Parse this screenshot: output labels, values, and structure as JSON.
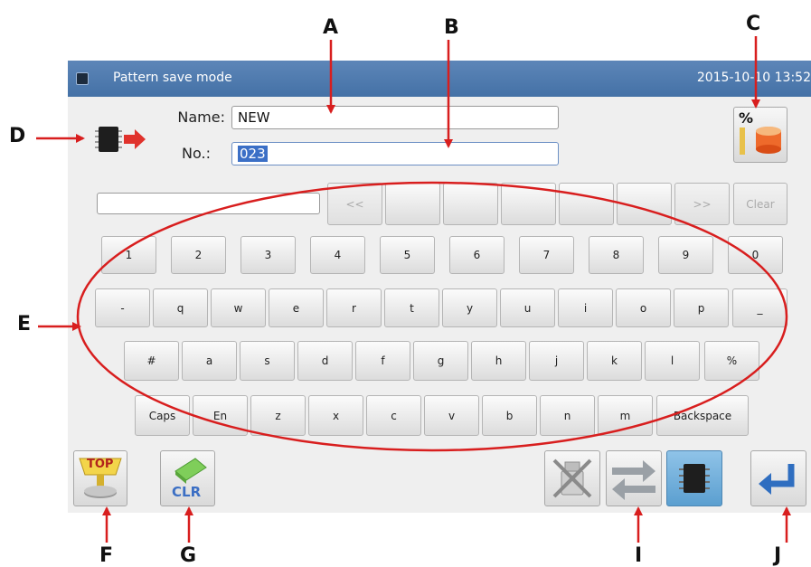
{
  "titlebar": {
    "title": "Pattern save mode",
    "clock": "2015-10-10 13:52"
  },
  "form": {
    "name_label": "Name:",
    "name_value": "NEW",
    "number_label": "No.:",
    "number_value": "023"
  },
  "candidate_bar": {
    "input_value": "",
    "prev_label": "<<",
    "next_label": ">>",
    "clear_label": "Clear",
    "candidates": [
      "",
      "",
      "",
      "",
      ""
    ]
  },
  "keyboard": {
    "row1": [
      "1",
      "2",
      "3",
      "4",
      "5",
      "6",
      "7",
      "8",
      "9",
      "0"
    ],
    "row2": [
      "-",
      "q",
      "w",
      "e",
      "r",
      "t",
      "y",
      "u",
      "i",
      "o",
      "p",
      "_"
    ],
    "row3": [
      "#",
      "a",
      "s",
      "d",
      "f",
      "g",
      "h",
      "j",
      "k",
      "l",
      "%"
    ],
    "row4": [
      "Caps",
      "En",
      "z",
      "x",
      "c",
      "v",
      "b",
      "n",
      "m",
      "Backspace"
    ]
  },
  "buttons": {
    "top_label": "TOP",
    "clr_label": "CLR",
    "percent_label": "%"
  },
  "icons": {
    "memory_arrow": "chip-arrow-icon",
    "capacity": "percent-capacity-icon",
    "top": "top-home-icon",
    "clear": "eraser-clr-icon",
    "usb_disabled": "usb-disabled-icon",
    "switch": "swap-arrows-icon",
    "memory": "chip-icon",
    "enter": "enter-return-icon"
  },
  "callouts": {
    "a": "A",
    "b": "B",
    "c": "C",
    "d": "D",
    "e": "E",
    "f": "F",
    "g": "G",
    "i": "I",
    "j": "J"
  },
  "colors": {
    "titlebar": "#4f7bb0",
    "annotation": "#d81e1e",
    "selection": "#3b6fc6"
  }
}
